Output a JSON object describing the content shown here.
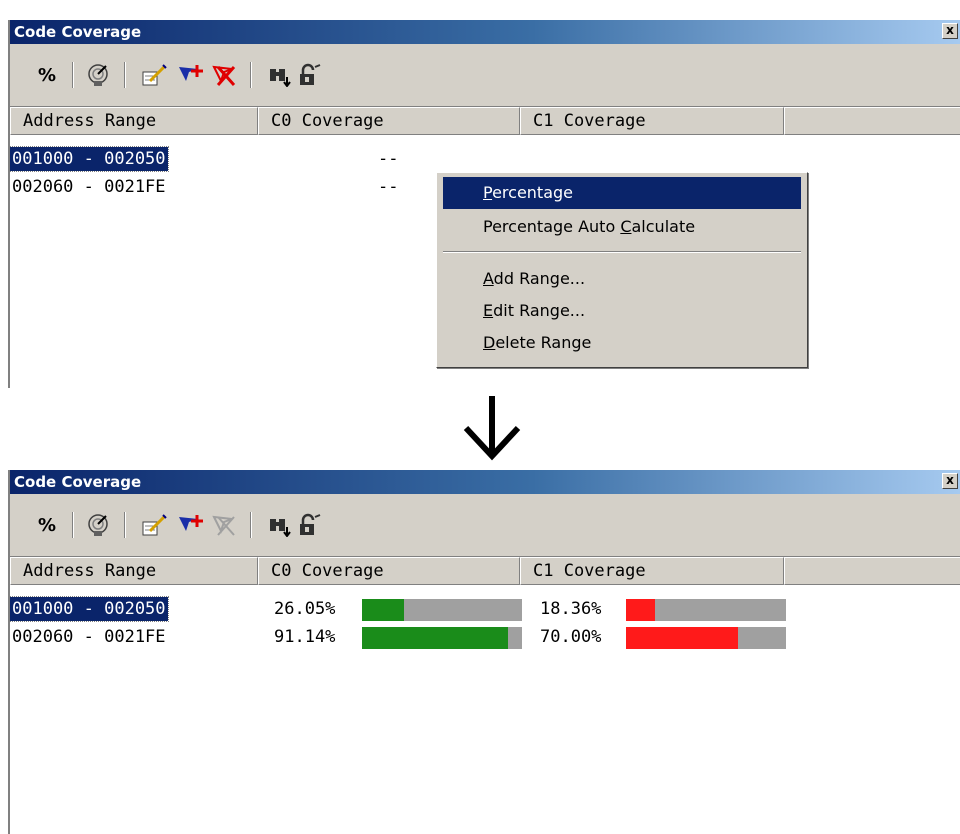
{
  "top_window": {
    "title": "Code Coverage",
    "close_label": "x",
    "toolbar": {
      "percent_label": "%"
    },
    "columns": [
      "Address Range",
      "C0 Coverage",
      "C1 Coverage",
      ""
    ],
    "rows": [
      {
        "range": "001000 - 002050",
        "c0": "--"
      },
      {
        "range": "002060 - 0021FE",
        "c0": "--"
      }
    ],
    "context_menu": {
      "items": [
        {
          "label": "Percentage",
          "underline": "P",
          "highlighted": true
        },
        {
          "label": "Percentage Auto Calculate",
          "underline": "C"
        },
        {
          "label": "Add Range...",
          "underline": "A"
        },
        {
          "label": "Edit Range...",
          "underline": "E"
        },
        {
          "label": "Delete Range",
          "underline": "D"
        }
      ]
    }
  },
  "bottom_window": {
    "title": "Code Coverage",
    "close_label": "x",
    "toolbar": {
      "percent_label": "%"
    },
    "columns": [
      "Address Range",
      "C0 Coverage",
      "C1 Coverage",
      ""
    ],
    "rows": [
      {
        "range": "001000 - 002050",
        "c0_text": "26.05%",
        "c0_value": 26.05,
        "c1_text": "18.36%",
        "c1_value": 18.36
      },
      {
        "range": "002060 - 0021FE",
        "c0_text": "91.14%",
        "c0_value": 91.14,
        "c1_text": "70.00%",
        "c1_value": 70.0
      }
    ]
  },
  "colors": {
    "c0_fill": "#1a8c1a",
    "c1_fill": "#ff1a1a",
    "bar_bg": "#a0a0a0",
    "selection": "#0a246a"
  },
  "icons": [
    "percent-icon",
    "radar-icon",
    "edit-range-icon",
    "add-range-icon",
    "delete-range-icon",
    "find-icon",
    "lock-icon",
    "down-arrow-icon"
  ]
}
